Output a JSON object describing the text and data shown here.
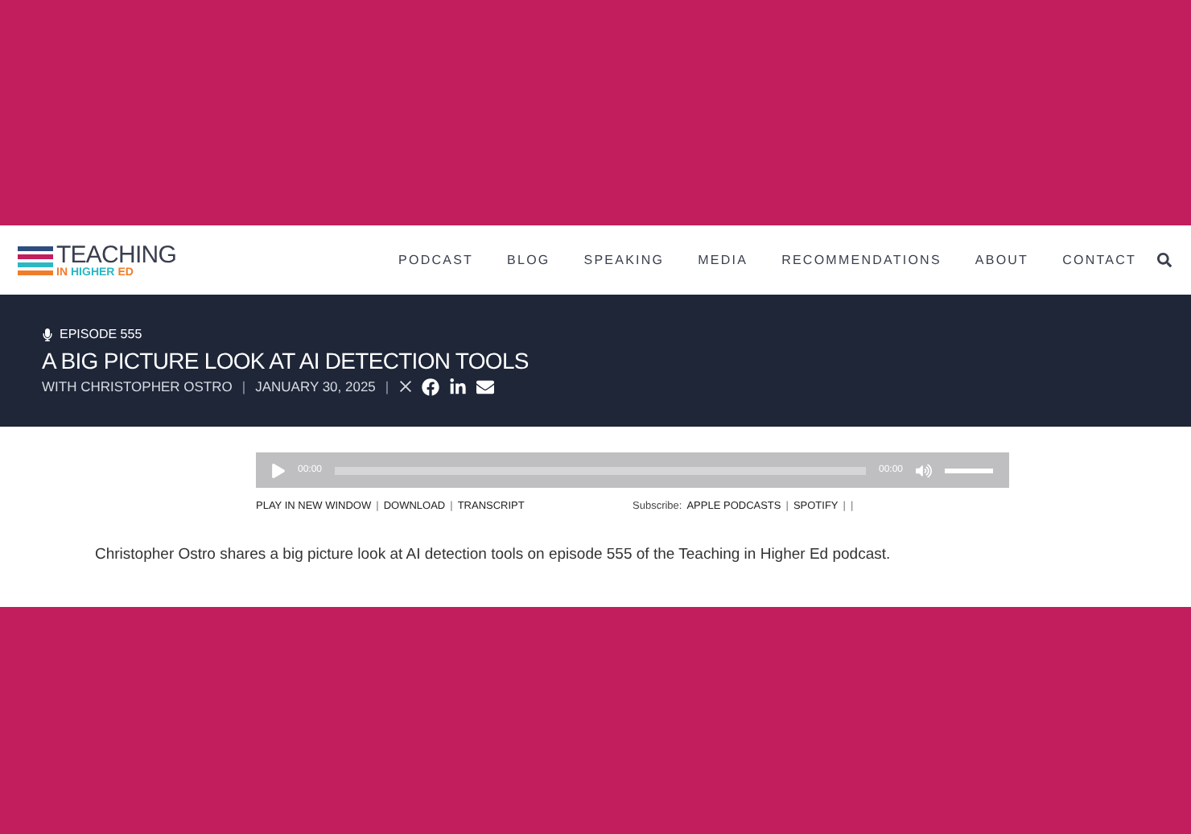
{
  "logo": {
    "title": "TEACHING",
    "subtitle": [
      {
        "text": "IN",
        "color": "#f07d2a"
      },
      {
        "text": "HIGHER",
        "color": "#2bb7c4"
      },
      {
        "text": "ED",
        "color": "#f07d2a"
      }
    ]
  },
  "nav": {
    "items": [
      "PODCAST",
      "BLOG",
      "SPEAKING",
      "MEDIA",
      "RECOMMENDATIONS",
      "ABOUT",
      "CONTACT"
    ]
  },
  "episode": {
    "label": "EPISODE 555",
    "title": "A BIG PICTURE LOOK AT AI DETECTION TOOLS",
    "meta": [
      {
        "kind": "text",
        "text": "WITH CHRISTOPHER OSTRO"
      },
      {
        "kind": "sep",
        "text": "|"
      },
      {
        "kind": "text",
        "text": "JANUARY 30, 2025"
      },
      {
        "kind": "sep",
        "text": "|"
      }
    ]
  },
  "player": {
    "elapsed": "00:00",
    "duration": "00:00",
    "volume": {
      "level": 1
    }
  },
  "links": [
    {
      "kind": "link",
      "text": "PLAY IN NEW WINDOW"
    },
    {
      "kind": "sep",
      "text": "|"
    },
    {
      "kind": "link",
      "text": "DOWNLOAD"
    },
    {
      "kind": "sep",
      "text": "|"
    },
    {
      "kind": "link",
      "text": "TRANSCRIPT"
    }
  ],
  "subscribe": [
    {
      "kind": "text",
      "text": "Subscribe:"
    },
    {
      "kind": "link",
      "text": "APPLE PODCASTS"
    },
    {
      "kind": "sep",
      "text": "|"
    },
    {
      "kind": "link",
      "text": "SPOTIFY"
    },
    {
      "kind": "sep",
      "text": "|"
    },
    {
      "kind": "sep",
      "text": "|"
    }
  ],
  "description": "Christopher Ostro shares a big picture look at AI detection tools on episode 555 of the Teaching in Higher Ed podcast."
}
